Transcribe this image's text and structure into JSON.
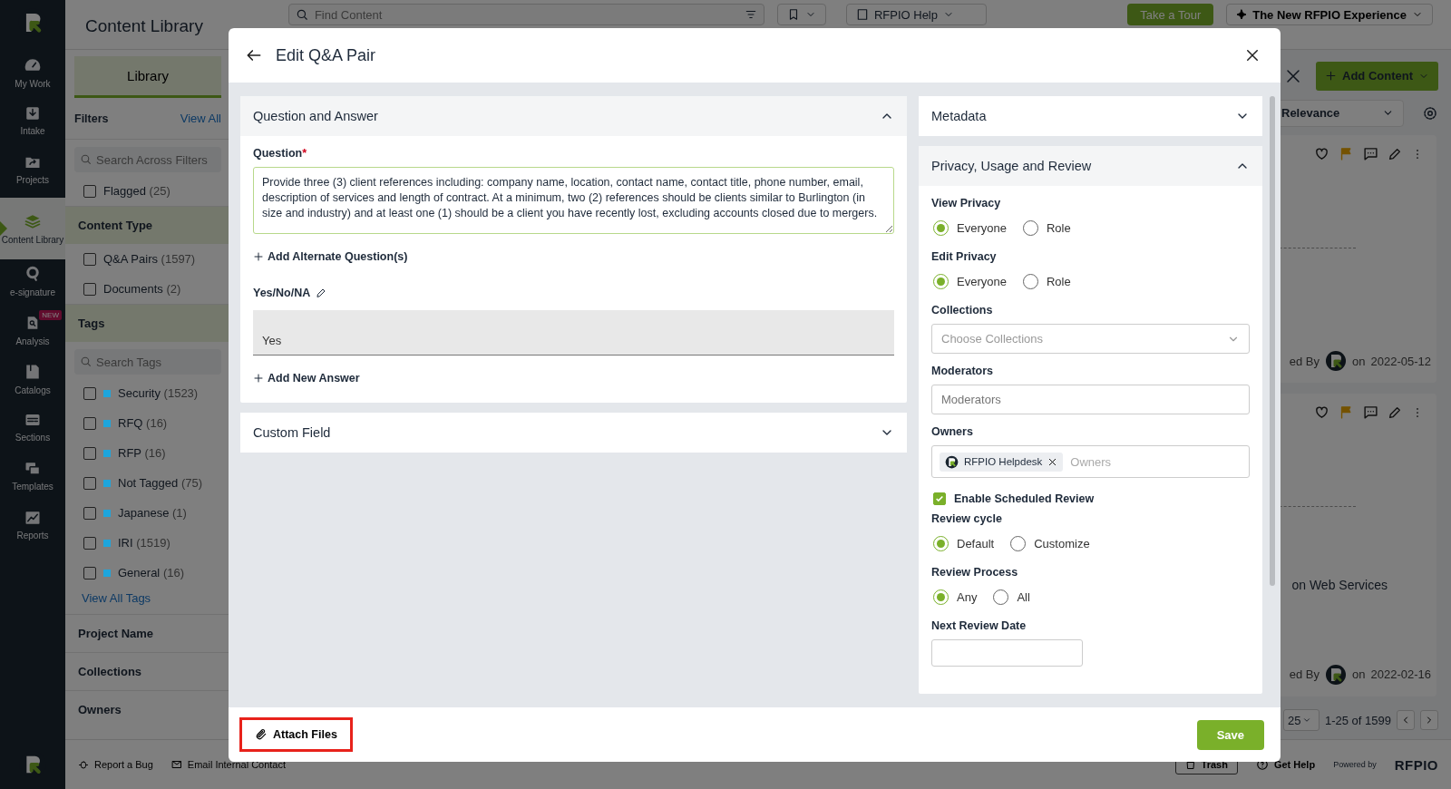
{
  "nav": {
    "items": [
      {
        "label": "My Work",
        "selected": false
      },
      {
        "label": "Intake",
        "selected": false
      },
      {
        "label": "Projects",
        "selected": false
      },
      {
        "label": "Content Library",
        "selected": true
      },
      {
        "label": "e-signature",
        "selected": false
      },
      {
        "label": "Analysis",
        "selected": false,
        "badge": "NEW"
      },
      {
        "label": "Catalogs",
        "selected": false
      },
      {
        "label": "Sections",
        "selected": false
      },
      {
        "label": "Templates",
        "selected": false
      },
      {
        "label": "Reports",
        "selected": false
      }
    ]
  },
  "header": {
    "title": "Content Library",
    "search_placeholder": "Find Content",
    "help_label": "RFPIO Help",
    "tour_button": "Take a Tour",
    "experience_button": "The New RFPIO Experience"
  },
  "library_tab": {
    "label": "Library",
    "selected": true
  },
  "filters": {
    "title": "Filters",
    "view_all": "View All",
    "search_placeholder": "Search Across Filters",
    "flagged": {
      "label": "Flagged",
      "count": "(25)",
      "checked": false
    },
    "groups": [
      {
        "title": "Content Type",
        "expanded": true,
        "items": [
          {
            "label": "Q&A Pairs",
            "count": "(1597)",
            "checked": false
          },
          {
            "label": "Documents",
            "count": "(2)",
            "checked": false
          }
        ]
      },
      {
        "title": "Tags",
        "expanded": true,
        "search_placeholder": "Search Tags",
        "view_all": "View All Tags",
        "items": [
          {
            "label": "Security",
            "count": "(1523)",
            "checked": false,
            "color": "#1ea5dc"
          },
          {
            "label": "RFQ",
            "count": "(16)",
            "checked": false,
            "color": "#1ea5dc"
          },
          {
            "label": "RFP",
            "count": "(16)",
            "checked": false,
            "color": "#1ea5dc"
          },
          {
            "label": "Not Tagged",
            "count": "(75)",
            "checked": false,
            "color": "#1ea5dc"
          },
          {
            "label": "Japanese",
            "count": "(1)",
            "checked": false,
            "color": "#1ea5dc"
          },
          {
            "label": "IRI",
            "count": "(1519)",
            "checked": false,
            "color": "#1ea5dc"
          },
          {
            "label": "General",
            "count": "(16)",
            "checked": false,
            "color": "#1ea5dc"
          }
        ]
      },
      {
        "title": "Project Name",
        "expanded": false
      },
      {
        "title": "Collections",
        "expanded": false
      },
      {
        "title": "Owners",
        "expanded": false
      }
    ]
  },
  "results": {
    "add_content": "Add Content",
    "sort": "Relevance",
    "cards": [
      {
        "flagged": true,
        "author_prefix": "ed By",
        "on": "on",
        "date": "2022-05-12"
      },
      {
        "flagged": true,
        "snippet": "on Web Services",
        "author_prefix": "ed By",
        "on": "on",
        "date": "2022-02-16"
      }
    ],
    "page_size": "25",
    "range": "1-25 of 1599"
  },
  "status_bar": {
    "report_bug": "Report a Bug",
    "email_contact": "Email Internal Contact",
    "trash": "Trash",
    "get_help": "Get Help",
    "powered_by": "Powered by",
    "brand": "RFPIO"
  },
  "modal": {
    "title": "Edit Q&A Pair",
    "qa_section": {
      "title": "Question and Answer",
      "expanded": true,
      "question_label": "Question",
      "required_mark": "*",
      "question": "Provide three (3) client references including: company name, location, contact name, contact title, phone number, email, description of services and length of contract. At a minimum, two (2) references should be clients similar to Burlington (in size and industry) and at least one (1) should be a client you have recently lost, excluding accounts closed due to mergers.",
      "add_alternate": "Add Alternate Question(s)",
      "answer_label": "Yes/No/NA",
      "answer_value": "Yes",
      "add_answer": "Add New Answer"
    },
    "custom_field": {
      "title": "Custom Field",
      "expanded": false
    },
    "metadata": {
      "title": "Metadata",
      "expanded": false
    },
    "privacy": {
      "title": "Privacy, Usage and Review",
      "expanded": true,
      "fields": [
        {
          "kind": "radio",
          "label": "View Privacy",
          "options": [
            {
              "label": "Everyone",
              "selected": true
            },
            {
              "label": "Role",
              "selected": false
            }
          ]
        },
        {
          "kind": "radio",
          "label": "Edit Privacy",
          "options": [
            {
              "label": "Everyone",
              "selected": true
            },
            {
              "label": "Role",
              "selected": false
            }
          ]
        },
        {
          "kind": "select",
          "label": "Collections",
          "placeholder": "Choose Collections"
        },
        {
          "kind": "input",
          "label": "Moderators",
          "placeholder": "Moderators"
        },
        {
          "kind": "tags",
          "label": "Owners",
          "tags": [
            "RFPIO Helpdesk"
          ],
          "placeholder": "Owners"
        },
        {
          "kind": "checkbox",
          "label": "Enable Scheduled Review",
          "checked": true
        },
        {
          "kind": "radio",
          "label": "Review cycle",
          "options": [
            {
              "label": "Default",
              "selected": true
            },
            {
              "label": "Customize",
              "selected": false
            }
          ]
        },
        {
          "kind": "radio",
          "label": "Review Process",
          "options": [
            {
              "label": "Any",
              "selected": true
            },
            {
              "label": "All",
              "selected": false
            }
          ]
        },
        {
          "kind": "date",
          "label": "Next Review Date"
        }
      ]
    },
    "attach_button": "Attach Files",
    "save_button": "Save"
  }
}
